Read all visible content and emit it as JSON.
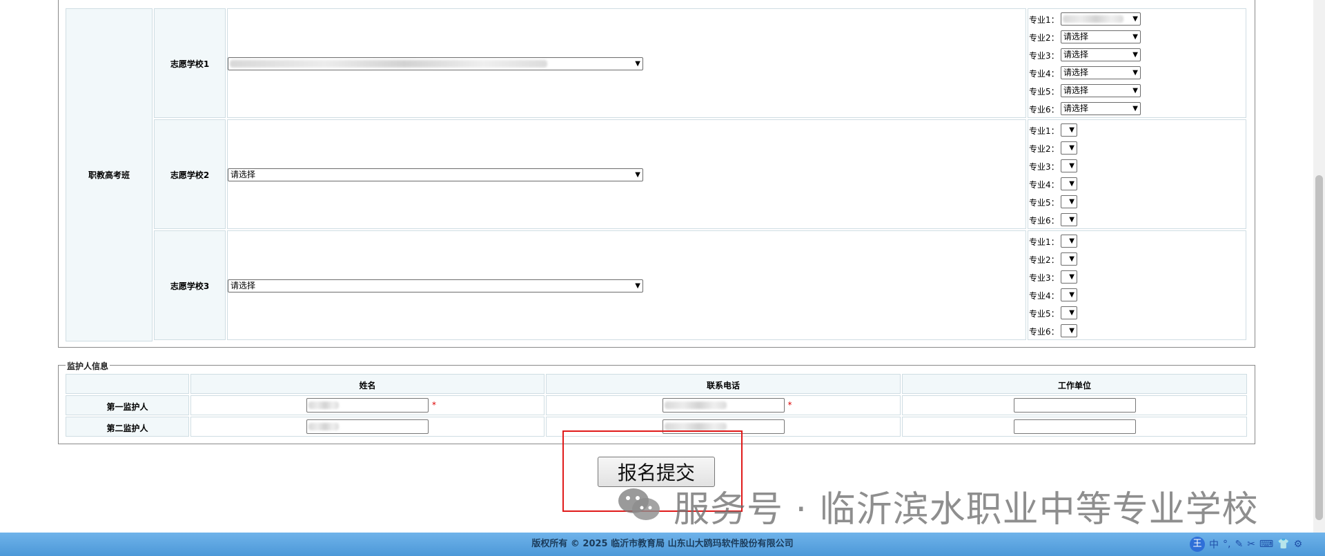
{
  "section": {
    "category_label": "职教高考班",
    "schools": [
      {
        "label": "志愿学校1",
        "selected": "",
        "blurred": true,
        "majors": [
          {
            "label": "专业1：",
            "value": "",
            "blurred": true
          },
          {
            "label": "专业2：",
            "value": "请选择"
          },
          {
            "label": "专业3：",
            "value": "请选择"
          },
          {
            "label": "专业4：",
            "value": "请选择"
          },
          {
            "label": "专业5：",
            "value": "请选择"
          },
          {
            "label": "专业6：",
            "value": "请选择"
          }
        ]
      },
      {
        "label": "志愿学校2",
        "selected": "请选择",
        "majors": [
          {
            "label": "专业1：",
            "value": ""
          },
          {
            "label": "专业2：",
            "value": ""
          },
          {
            "label": "专业3：",
            "value": ""
          },
          {
            "label": "专业4：",
            "value": ""
          },
          {
            "label": "专业5：",
            "value": ""
          },
          {
            "label": "专业6：",
            "value": ""
          }
        ]
      },
      {
        "label": "志愿学校3",
        "selected": "请选择",
        "majors": [
          {
            "label": "专业1：",
            "value": ""
          },
          {
            "label": "专业2：",
            "value": ""
          },
          {
            "label": "专业3：",
            "value": ""
          },
          {
            "label": "专业4：",
            "value": ""
          },
          {
            "label": "专业5：",
            "value": ""
          },
          {
            "label": "专业6：",
            "value": ""
          }
        ]
      }
    ]
  },
  "guardian": {
    "legend": "监护人信息",
    "headers": [
      "姓名",
      "联系电话",
      "工作单位"
    ],
    "rows": [
      {
        "label": "第一监护人",
        "name": "",
        "phone": "",
        "work": "",
        "required": true
      },
      {
        "label": "第二监护人",
        "name": "",
        "phone": "",
        "work": "",
        "required": false
      }
    ],
    "required_mark": "*"
  },
  "submit_label": "报名提交",
  "watermark": "服务号 · 临沂滨水职业中等专业学校",
  "footer": "版权所有 © 2025 临沂市教育局 山东山大鸥玛软件股份有限公司",
  "tray": {
    "ime": "王",
    "items": [
      "中",
      "°,",
      "✎",
      "✂",
      "⌨",
      "👕",
      "⚙"
    ]
  },
  "colors": {
    "accent": "#4c98d8",
    "highlight": "#e01919",
    "cell_bg": "#f2f8fa"
  }
}
